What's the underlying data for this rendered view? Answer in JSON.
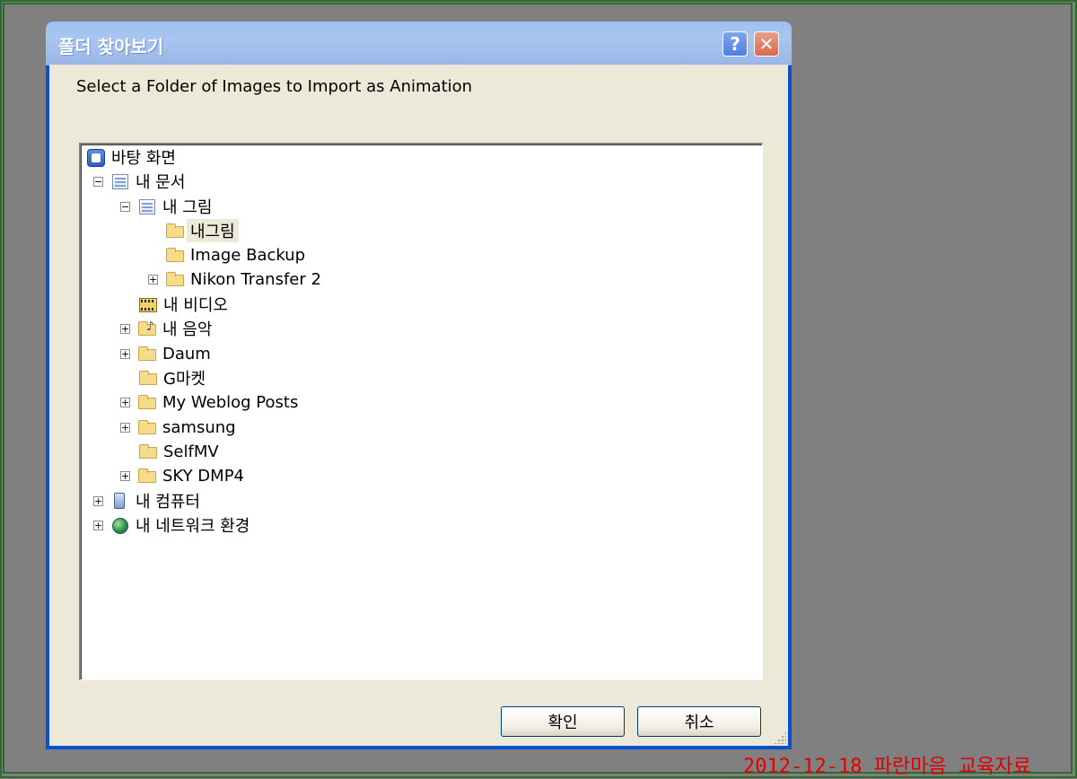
{
  "window": {
    "title": "폴더 찾아보기",
    "help_label": "?",
    "close_label": "✕"
  },
  "prompt": "Select a Folder of Images to Import as Animation",
  "tree": {
    "nodes": [
      {
        "label": "바탕 화면",
        "icon": "desktop-icon",
        "expander": ""
      },
      {
        "label": "내 문서",
        "icon": "my-documents-icon",
        "expander": "⊟"
      },
      {
        "label": "내 그림",
        "icon": "my-pictures-icon",
        "expander": "⊟"
      },
      {
        "label": "내그림",
        "icon": "folder-icon",
        "expander": "",
        "selected": true
      },
      {
        "label": "Image Backup",
        "icon": "folder-icon",
        "expander": ""
      },
      {
        "label": "Nikon Transfer 2",
        "icon": "folder-icon",
        "expander": "⊞"
      },
      {
        "label": "내 비디오",
        "icon": "my-videos-icon",
        "expander": ""
      },
      {
        "label": "내 음악",
        "icon": "my-music-icon",
        "expander": "⊞"
      },
      {
        "label": "Daum",
        "icon": "folder-icon",
        "expander": "⊞"
      },
      {
        "label": "G마켓",
        "icon": "folder-icon",
        "expander": ""
      },
      {
        "label": "My Weblog Posts",
        "icon": "folder-icon",
        "expander": "⊞"
      },
      {
        "label": "samsung",
        "icon": "folder-icon",
        "expander": "⊞"
      },
      {
        "label": "SelfMV",
        "icon": "folder-icon",
        "expander": ""
      },
      {
        "label": "SKY DMP4",
        "icon": "folder-icon",
        "expander": "⊞"
      },
      {
        "label": "내 컴퓨터",
        "icon": "my-computer-icon",
        "expander": "⊞"
      },
      {
        "label": "내 네트워크 환경",
        "icon": "network-icon",
        "expander": "⊞"
      }
    ]
  },
  "buttons": {
    "ok": "확인",
    "cancel": "취소"
  },
  "caption": "2012-12-18 파란마음 교육자료"
}
